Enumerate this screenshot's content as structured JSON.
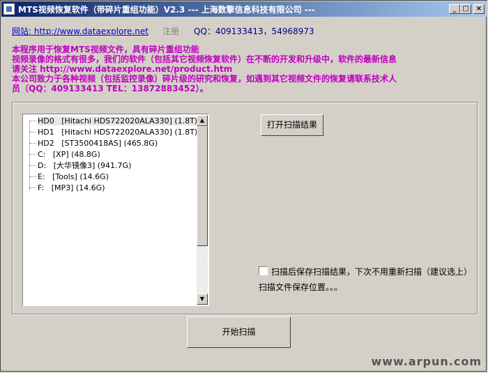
{
  "window": {
    "title": "MTS视频恢复软件（带碎片重组功能）V2.3 --- 上海数擎信息科技有限公司 ---",
    "controls": {
      "minimize": "_",
      "maximize": "□",
      "close": "×"
    }
  },
  "header": {
    "website_label": "网站: http://www.dataexplore.net",
    "register_label": "注册",
    "qq_label": "QQ：409133413，54968973"
  },
  "info": {
    "lines": [
      "本程序用于恢复MTS视频文件，具有碎片重组功能",
      "视频录像的格式有很多，我们的软件（包括其它视频恢复软件）在不断的开发和升级中，软件的最新信息",
      "请关注 http://www.dataexplore.net/product.htm",
      "本公司致力于各种视频（包括监控录像）碎片级的研究和恢复，如遇到其它视频文件的恢复请联系技术人",
      "员（QQ：409133413  TEL：13872883452）。"
    ]
  },
  "drive_tree": {
    "items": [
      {
        "id": "HD0",
        "desc": "[Hitachi HDS722020ALA330] (1.8T)",
        "selected": true
      },
      {
        "id": "HD1",
        "desc": "[Hitachi HDS722020ALA330] (1.8T)",
        "selected": false
      },
      {
        "id": "HD2",
        "desc": "[ST3500418AS] (465.8G)",
        "selected": false
      },
      {
        "id": "C:",
        "desc": "[XP] (48.8G)",
        "selected": false
      },
      {
        "id": "D:",
        "desc": "[大华镜像3] (941.7G)",
        "selected": false
      },
      {
        "id": "E:",
        "desc": "[Tools] (14.6G)",
        "selected": false
      },
      {
        "id": "F:",
        "desc": "[MP3] (14.6G)",
        "selected": false
      }
    ]
  },
  "buttons": {
    "open_scan_result": "打开扫描结果",
    "start_scan": "开始扫描"
  },
  "options": {
    "save_after_scan_label": "扫描后保存扫描结果，下次不用重新扫描（建议选上）",
    "save_after_scan_checked": false,
    "save_location_label": "扫描文件保存位置。。。"
  },
  "watermark": "www.arpun.com"
}
